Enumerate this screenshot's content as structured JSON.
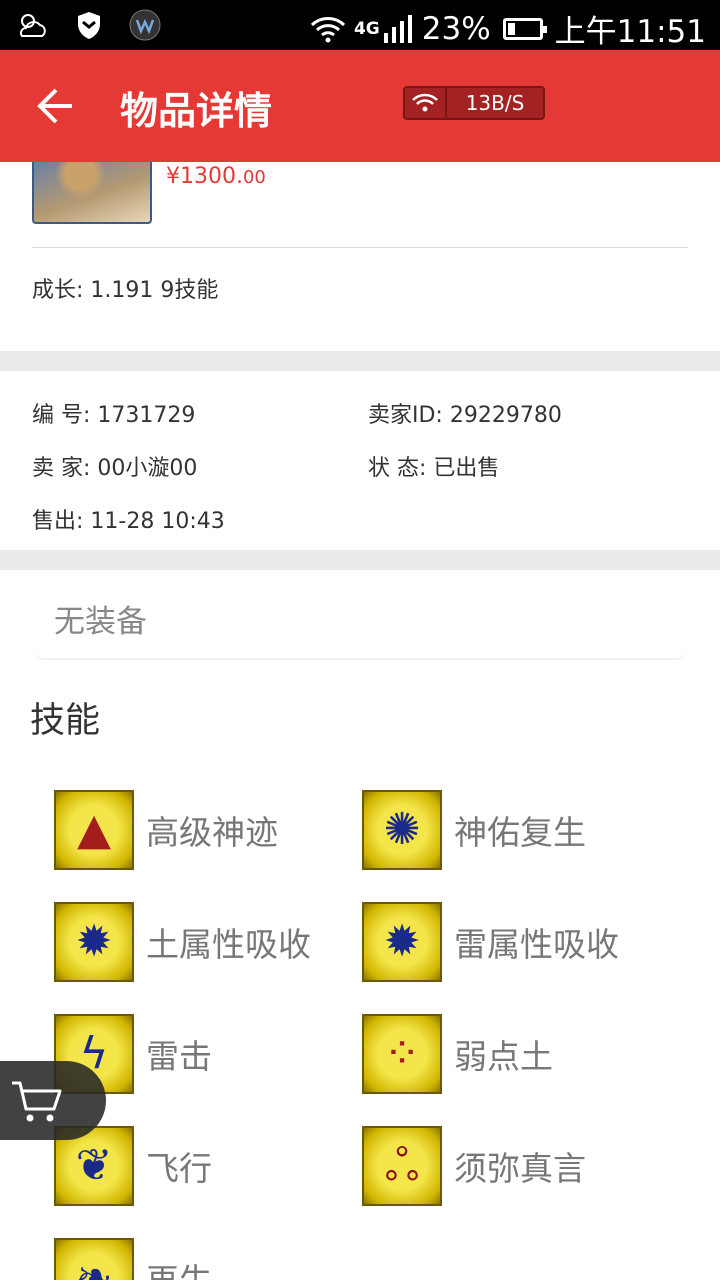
{
  "status_bar": {
    "network": "4G",
    "battery": "23%",
    "time": "上午11:51"
  },
  "app_bar": {
    "title": "物品详情",
    "speed": "13B/S"
  },
  "item": {
    "price_main": "¥1300.",
    "price_decimal": "00",
    "growth": "成长: 1.191  9技能"
  },
  "info": {
    "id_label": "编  号:",
    "id_value": "1731729",
    "seller_id_label": "卖家ID:",
    "seller_id_value": "29229780",
    "seller_label": "卖  家:",
    "seller_value": "00小漩00",
    "status_label": "状  态:",
    "status_value": "已出售",
    "sold_label": "售出:",
    "sold_value": "11-28 10:43"
  },
  "equipment": {
    "empty_text": "无装备"
  },
  "skills": {
    "title": "技能",
    "items": [
      {
        "name": "高级神迹",
        "icon": "red-flame-icon"
      },
      {
        "name": "神佑复生",
        "icon": "blue-beast-icon"
      },
      {
        "name": "土属性吸收",
        "icon": "earth-wheel-icon"
      },
      {
        "name": "雷属性吸收",
        "icon": "thunder-wheel-icon"
      },
      {
        "name": "雷击",
        "icon": "lightning-icon"
      },
      {
        "name": "弱点土",
        "icon": "rock-dots-icon"
      },
      {
        "name": "飞行",
        "icon": "wing-icon"
      },
      {
        "name": "须弥真言",
        "icon": "sigil-icon"
      },
      {
        "name": "再生",
        "icon": "regen-icon"
      }
    ]
  },
  "colors": {
    "accent": "#e53935",
    "price": "#e53935"
  }
}
